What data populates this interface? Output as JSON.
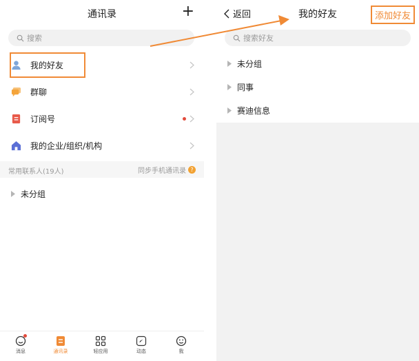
{
  "left": {
    "title": "通讯录",
    "plus": "+",
    "search_placeholder": "搜索",
    "rows": [
      {
        "label": "我的好友",
        "icon": "person-icon"
      },
      {
        "label": "群聊",
        "icon": "chat-bubbles-icon"
      },
      {
        "label": "订阅号",
        "icon": "bookmark-icon"
      },
      {
        "label": "我的企业/组织/机构",
        "icon": "home-icon"
      }
    ],
    "section": {
      "label": "常用联系人(19人)",
      "sync": "同步手机通讯录",
      "help": "?"
    },
    "groups": [
      {
        "label": "未分组"
      }
    ],
    "tabs": [
      {
        "label": "消息",
        "icon": "message-icon"
      },
      {
        "label": "通讯录",
        "icon": "contacts-icon"
      },
      {
        "label": "轻应用",
        "icon": "apps-grid-icon"
      },
      {
        "label": "动态",
        "icon": "compass-icon"
      },
      {
        "label": "我",
        "icon": "smiley-icon"
      }
    ]
  },
  "right": {
    "back": "返回",
    "title": "我的好友",
    "add_friend": "添加好友",
    "search_placeholder": "搜索好友",
    "groups": [
      {
        "label": "未分组"
      },
      {
        "label": "同事"
      },
      {
        "label": "赛迪信息"
      }
    ]
  },
  "colors": {
    "accent": "#f08a35",
    "badge": "#e24a3b",
    "person_icon": "#7fa6d8",
    "chat_icon": "#f4a43a",
    "bookmark_icon": "#e85a4a",
    "home_icon": "#5b6fd6"
  }
}
